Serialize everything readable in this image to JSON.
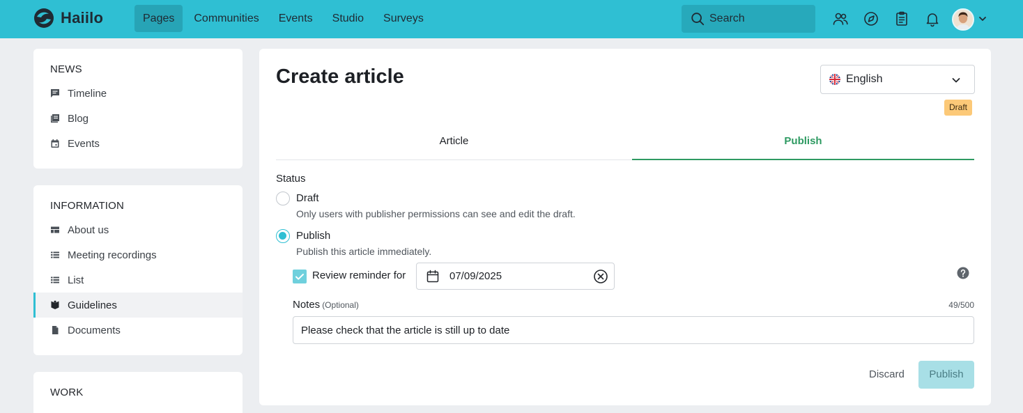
{
  "app": {
    "name": "Haiilo",
    "nav": [
      {
        "label": "Pages",
        "active": true
      },
      {
        "label": "Communities",
        "active": false
      },
      {
        "label": "Events",
        "active": false
      },
      {
        "label": "Studio",
        "active": false
      },
      {
        "label": "Surveys",
        "active": false
      }
    ],
    "search_label": "Search",
    "brand_color": "#2fbfd3"
  },
  "sidebar": {
    "sections": [
      {
        "heading": "NEWS",
        "items": [
          {
            "label": "Timeline",
            "icon": "timeline-icon"
          },
          {
            "label": "Blog",
            "icon": "blog-icon"
          },
          {
            "label": "Events",
            "icon": "calendar-icon"
          }
        ]
      },
      {
        "heading": "INFORMATION",
        "items": [
          {
            "label": "About us",
            "icon": "page-icon"
          },
          {
            "label": "Meeting recordings",
            "icon": "list-icon"
          },
          {
            "label": "List",
            "icon": "list-icon"
          },
          {
            "label": "Guidelines",
            "icon": "book-icon",
            "active": true
          },
          {
            "label": "Documents",
            "icon": "document-icon"
          }
        ]
      },
      {
        "heading": "WORK",
        "items": []
      }
    ]
  },
  "main": {
    "title": "Create article",
    "language": "English",
    "badge": "Draft",
    "tabs": [
      {
        "label": "Article",
        "active": false
      },
      {
        "label": "Publish",
        "active": true
      }
    ],
    "status": {
      "label": "Status",
      "options": [
        {
          "label": "Draft",
          "help": "Only users with publisher permissions can see and edit the draft.",
          "checked": false
        },
        {
          "label": "Publish",
          "help": "Publish this article immediately.",
          "checked": true
        }
      ]
    },
    "review": {
      "label": "Review reminder for",
      "checked": true,
      "date": "07/09/2025"
    },
    "notes": {
      "label": "Notes",
      "optional": "(Optional)",
      "count": "49/500",
      "value": "Please check that the article is still up to date"
    },
    "actions": {
      "discard": "Discard",
      "publish": "Publish"
    }
  }
}
